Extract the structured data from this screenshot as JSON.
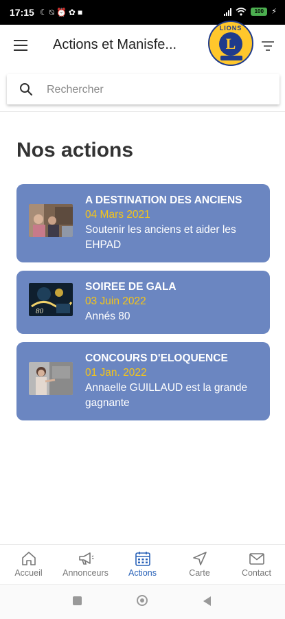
{
  "status_bar": {
    "time": "17:15",
    "left_icons": [
      "moon-icon",
      "notifications-off-icon",
      "alarm-icon",
      "app-icon",
      "square-icon"
    ],
    "right_icons": [
      "signal-icon",
      "wifi-icon",
      "battery-icon"
    ],
    "battery": "100",
    "battery_color": "#4caf50"
  },
  "app_bar": {
    "title": "Actions et Manisfe...",
    "logo_text": "LIONS",
    "logo_letter": "L",
    "menu_icon": "hamburger-menu-icon",
    "filter_icon": "filter-icon"
  },
  "search": {
    "placeholder": "Rechercher",
    "value": ""
  },
  "section": {
    "title": "Nos actions"
  },
  "actions": [
    {
      "title": "A DESTINATION DES ANCIENS",
      "date": "04 Mars 2021",
      "description": "Soutenir les anciens et aider les EHPAD"
    },
    {
      "title": "SOIREE DE GALA",
      "date": "03 Juin 2022",
      "description": "Annés 80"
    },
    {
      "title": "CONCOURS D'ELOQUENCE",
      "date": "01 Jan. 2022",
      "description": "Annaelle GUILLAUD est la grande gagnante"
    }
  ],
  "bottom_nav": {
    "items": [
      {
        "label": "Accueil",
        "icon": "home-icon"
      },
      {
        "label": "Annonceurs",
        "icon": "megaphone-icon"
      },
      {
        "label": "Actions",
        "icon": "calendar-icon",
        "active": true
      },
      {
        "label": "Carte",
        "icon": "navigation-arrow-icon"
      },
      {
        "label": "Contact",
        "icon": "mail-icon"
      }
    ]
  },
  "colors": {
    "card_background": "#6b86c1",
    "date_accent": "#f5c518",
    "active_nav": "#2962b8",
    "logo_gold": "#ffc72c",
    "logo_blue": "#1f3b8c"
  }
}
